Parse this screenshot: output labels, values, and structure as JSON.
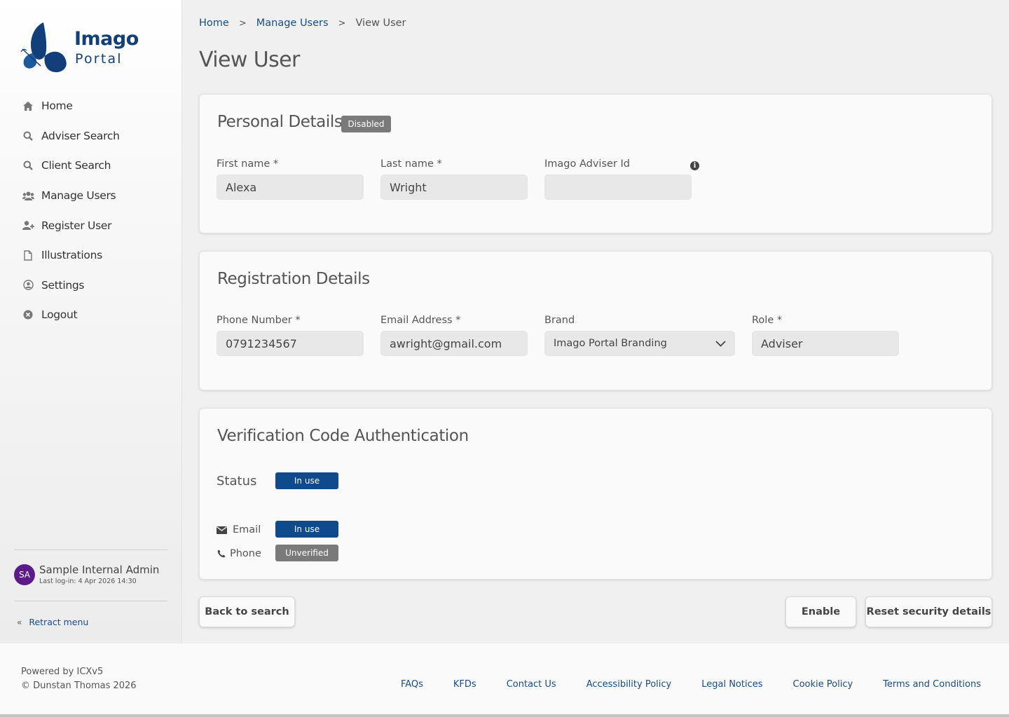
{
  "logo": {
    "line1": "Imago",
    "line2": "Portal"
  },
  "sidebar": {
    "items": [
      {
        "label": "Home",
        "icon": "home-icon"
      },
      {
        "label": "Adviser Search",
        "icon": "search-icon"
      },
      {
        "label": "Client Search",
        "icon": "search-icon"
      },
      {
        "label": "Manage Users",
        "icon": "users-icon"
      },
      {
        "label": "Register User",
        "icon": "user-plus-icon"
      },
      {
        "label": "Illustrations",
        "icon": "file-icon"
      },
      {
        "label": "Settings",
        "icon": "user-circle-icon"
      },
      {
        "label": "Logout",
        "icon": "close-circle-icon"
      }
    ],
    "user": {
      "initials": "SA",
      "name": "Sample Internal Admin",
      "last_login": "Last log-in: 4 Apr 2026 14:30",
      "avatar_color": "#5b1b89"
    },
    "retract_label": "Retract menu"
  },
  "breadcrumb": {
    "home": "Home",
    "manage_users": "Manage Users",
    "current": "View User",
    "separator": ">"
  },
  "page_title": "View User",
  "personal": {
    "title": "Personal Details",
    "status_badge": "Disabled",
    "first_name_label": "First name *",
    "first_name_value": "Alexa",
    "last_name_label": "Last name *",
    "last_name_value": "Wright",
    "adviser_id_label": "Imago Adviser Id",
    "adviser_id_value": ""
  },
  "registration": {
    "title": "Registration Details",
    "phone_label": "Phone Number *",
    "phone_value": "0791234567",
    "email_label": "Email Address *",
    "email_value": "awright@gmail.com",
    "brand_label": "Brand",
    "brand_value": "Imago Portal Branding",
    "role_label": "Role *",
    "role_value": "Adviser"
  },
  "verification": {
    "title": "Verification Code Authentication",
    "status_label": "Status",
    "status_value": "In use",
    "email_label": "Email",
    "email_status": "In use",
    "phone_label": "Phone",
    "phone_status": "Unverified"
  },
  "actions": {
    "back": "Back to search",
    "enable": "Enable",
    "reset": "Reset security details"
  },
  "footer": {
    "powered_by": "Powered by ICXv5",
    "copyright": "© Dunstan Thomas 2026",
    "links": [
      "FAQs",
      "KFDs",
      "Contact Us",
      "Accessibility Policy",
      "Legal Notices",
      "Cookie Policy",
      "Terms and Conditions"
    ]
  },
  "colors": {
    "brand_blue": "#123f7a",
    "link_blue": "#174d87",
    "badge_blue": "#0e4a8c",
    "badge_grey": "#7a7a7a"
  }
}
